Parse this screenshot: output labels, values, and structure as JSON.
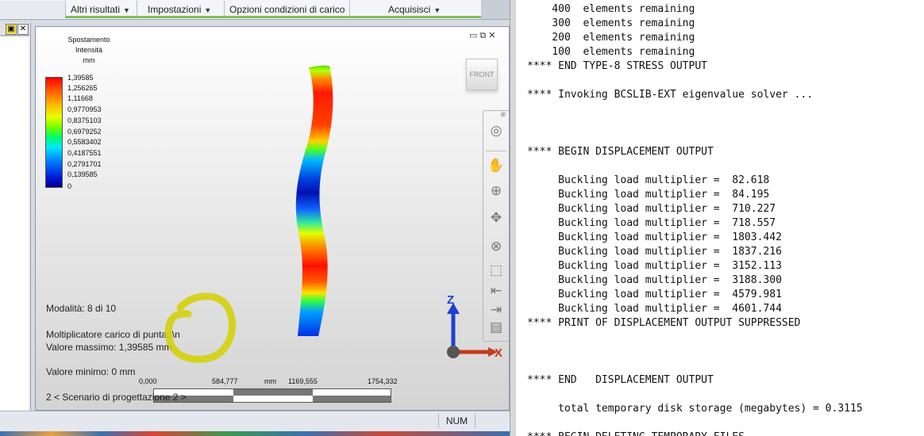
{
  "ribbon": {
    "items": [
      {
        "label": "Altri risultati"
      },
      {
        "label": "Impostazioni"
      },
      {
        "label": "Opzioni condizioni di carico"
      },
      {
        "label": "Acquisisci"
      }
    ]
  },
  "left_strip": {
    "pin": "▣",
    "close": "✕"
  },
  "legend": {
    "title": [
      "Spostamento",
      "Intensità",
      "mm"
    ],
    "values": [
      "1,39585",
      "1,256265",
      "1,11668",
      "0,9770953",
      "0,8375103",
      "0,6979252",
      "0,5583402",
      "0,4187551",
      "0,2791701",
      "0,139585",
      "0"
    ]
  },
  "viewcube": {
    "label": "FRONT"
  },
  "info": {
    "mode": "Modalità:  8 di 10",
    "multiplier": "Moltiplicatore carico di punta: \\n",
    "max": "Valore massimo: 1,39585 mm",
    "min": "Valore minimo: 0 mm",
    "scenario": "2 < Scenario di progettazione 2 >"
  },
  "scale": {
    "ticks": [
      "0,000",
      "584,777",
      "1169,555",
      "1754,332"
    ],
    "unit": "mm"
  },
  "axis": {
    "z": "Z",
    "x": "X"
  },
  "statusbar": {
    "num": "NUM"
  },
  "console": {
    "lines": [
      "    400  elements remaining",
      "    300  elements remaining",
      "    200  elements remaining",
      "    100  elements remaining",
      "**** END TYPE-8 STRESS OUTPUT",
      "",
      "**** Invoking BCSLIB-EXT eigenvalue solver ...",
      "",
      "",
      "",
      "**** BEGIN DISPLACEMENT OUTPUT",
      "",
      "     Buckling load multiplier =  82.618",
      "     Buckling load multiplier =  84.195",
      "     Buckling load multiplier =  710.227",
      "     Buckling load multiplier =  718.557",
      "     Buckling load multiplier =  1803.442",
      "     Buckling load multiplier =  1837.216",
      "     Buckling load multiplier =  3152.113",
      "     Buckling load multiplier =  3188.300",
      "     Buckling load multiplier =  4579.981",
      "     Buckling load multiplier =  4601.744",
      "**** PRINT OF DISPLACEMENT OUTPUT SUPPRESSED",
      "",
      "",
      "",
      "**** END   DISPLACEMENT OUTPUT",
      "",
      "     total temporary disk storage (megabytes) = 0.3115",
      "",
      "**** BEGIN DELETING TEMPORARY FILES"
    ]
  },
  "colors": {
    "highlight_circle": "#d4d000",
    "axis_z": "#1f3fd0",
    "axis_x": "#c83a1a"
  }
}
